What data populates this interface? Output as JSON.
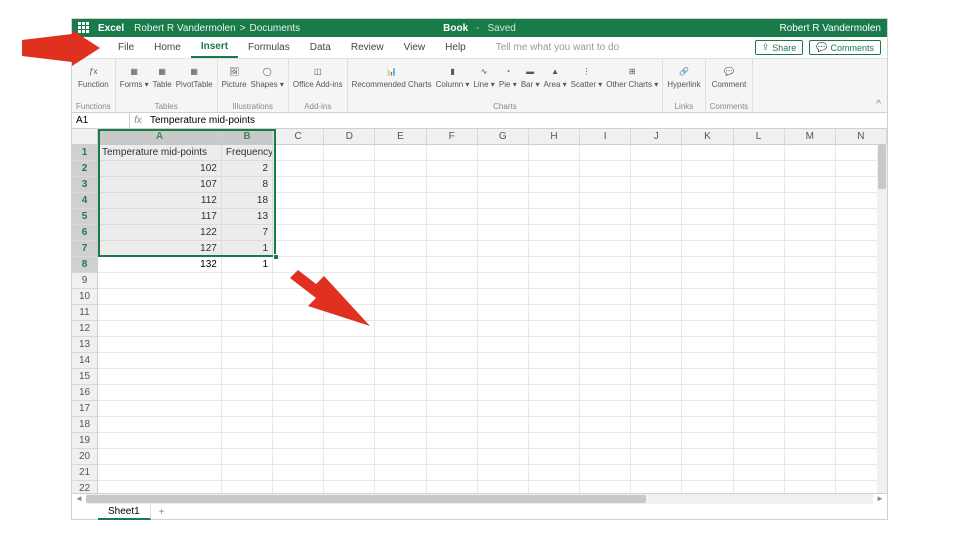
{
  "titlebar": {
    "app": "Excel",
    "crumb_user": "Robert R Vandermolen",
    "crumb_sep": ">",
    "crumb_loc": "Documents",
    "doc": "Book",
    "dash": "-",
    "saved": "Saved",
    "user_right": "Robert R Vandermolen"
  },
  "menu": {
    "items": [
      "File",
      "Home",
      "Insert",
      "Formulas",
      "Data",
      "Review",
      "View",
      "Help"
    ],
    "active_index": 2,
    "tellme": "Tell me what you want to do",
    "share": "Share",
    "comments": "Comments"
  },
  "ribbon": {
    "groups": [
      {
        "name": "Functions",
        "buttons": [
          {
            "label": "Function",
            "icon": "fx"
          }
        ]
      },
      {
        "name": "Tables",
        "buttons": [
          {
            "label": "Forms ▾",
            "icon": "forms"
          },
          {
            "label": "Table",
            "icon": "table"
          },
          {
            "label": "PivotTable",
            "icon": "pivot"
          }
        ]
      },
      {
        "name": "Illustrations",
        "buttons": [
          {
            "label": "Picture",
            "icon": "picture"
          },
          {
            "label": "Shapes ▾",
            "icon": "shapes"
          }
        ]
      },
      {
        "name": "Add-ins",
        "buttons": [
          {
            "label": "Office Add-ins",
            "icon": "addins"
          }
        ]
      },
      {
        "name": "Charts",
        "buttons": [
          {
            "label": "Recommended Charts",
            "icon": "recchart"
          },
          {
            "label": "Column ▾",
            "icon": "column"
          },
          {
            "label": "Line ▾",
            "icon": "line"
          },
          {
            "label": "Pie ▾",
            "icon": "pie"
          },
          {
            "label": "Bar ▾",
            "icon": "bar"
          },
          {
            "label": "Area ▾",
            "icon": "area"
          },
          {
            "label": "Scatter ▾",
            "icon": "scatter"
          },
          {
            "label": "Other Charts ▾",
            "icon": "other"
          }
        ]
      },
      {
        "name": "Links",
        "buttons": [
          {
            "label": "Hyperlink",
            "icon": "link"
          }
        ]
      },
      {
        "name": "Comments",
        "buttons": [
          {
            "label": "Comment",
            "icon": "comment"
          }
        ]
      }
    ],
    "collapse": "^"
  },
  "formula_bar": {
    "namebox": "A1",
    "fx": "fx",
    "value": "Temperature mid-points"
  },
  "grid": {
    "columns": [
      "A",
      "B",
      "C",
      "D",
      "E",
      "F",
      "G",
      "H",
      "I",
      "J",
      "K",
      "L",
      "M",
      "N"
    ],
    "sel_cols": [
      "A",
      "B"
    ],
    "row_count": 22,
    "sel_rows": [
      1,
      2,
      3,
      4,
      5,
      6,
      7,
      8
    ],
    "data": [
      [
        "Temperature mid-points",
        "Frequency"
      ],
      [
        "102",
        "2"
      ],
      [
        "107",
        "8"
      ],
      [
        "112",
        "18"
      ],
      [
        "117",
        "13"
      ],
      [
        "122",
        "7"
      ],
      [
        "127",
        "1"
      ],
      [
        "132",
        "1"
      ]
    ],
    "active_cell": "A1",
    "selection": {
      "top_row": 1,
      "bottom_row": 8,
      "left_col": "A",
      "right_col": "B"
    }
  },
  "tabs": {
    "sheet": "Sheet1",
    "add": "+"
  }
}
